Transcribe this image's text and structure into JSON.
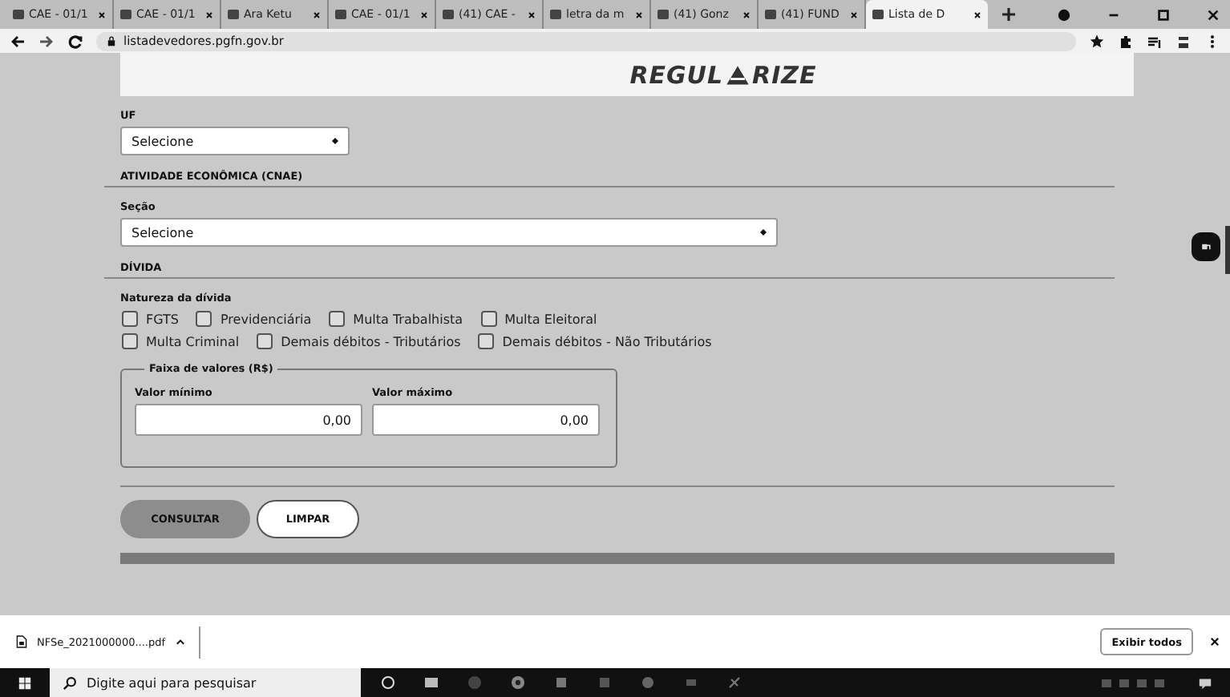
{
  "browser": {
    "tabs": [
      {
        "title": "CAE - 01/1",
        "selected": false
      },
      {
        "title": "CAE - 01/1",
        "selected": false
      },
      {
        "title": "Ara Ketu",
        "selected": false
      },
      {
        "title": "CAE - 01/1",
        "selected": false
      },
      {
        "title": "(41) CAE -",
        "selected": false
      },
      {
        "title": "letra da m",
        "selected": false
      },
      {
        "title": "(41) Gonz",
        "selected": false
      },
      {
        "title": "(41) FUND",
        "selected": false
      },
      {
        "title": "Lista de D",
        "selected": true
      }
    ],
    "address": "listadevedores.pgfn.gov.br"
  },
  "header": {
    "logo_before": "REGUL",
    "logo_after": "RIZE"
  },
  "form": {
    "uf": {
      "label": "UF",
      "value": "Selecione"
    },
    "cnae": {
      "heading": "ATIVIDADE ECONÔMICA (CNAE)",
      "label": "Seção",
      "value": "Selecione"
    },
    "divida": {
      "heading": "DÍVIDA",
      "label": "Natureza da dívida",
      "options": [
        [
          {
            "label": "FGTS",
            "checked": false
          },
          {
            "label": "Previdenciária",
            "checked": false
          },
          {
            "label": "Multa Trabalhista",
            "checked": false
          },
          {
            "label": "Multa Eleitoral",
            "checked": false
          }
        ],
        [
          {
            "label": "Multa Criminal",
            "checked": false
          },
          {
            "label": "Demais débitos - Tributários",
            "checked": false
          },
          {
            "label": "Demais débitos - Não Tributários",
            "checked": false
          }
        ]
      ]
    },
    "range": {
      "legend": "Faixa de valores (R$)",
      "min_label": "Valor mínimo",
      "min_value": "0,00",
      "max_label": "Valor máximo",
      "max_value": "0,00"
    },
    "buttons": [
      {
        "label": "CONSULTAR",
        "kind": "primary"
      },
      {
        "label": "LIMPAR",
        "kind": "secondary"
      }
    ]
  },
  "download_bar": {
    "file": "NFSe_2021000000....pdf",
    "show_all": "Exibir todos"
  },
  "taskbar": {
    "search_placeholder": "Digite aqui para pesquisar"
  }
}
